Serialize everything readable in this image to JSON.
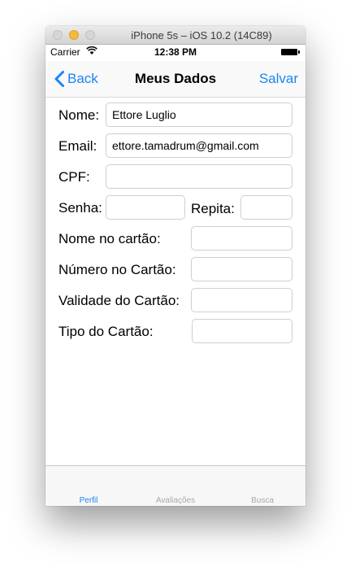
{
  "window": {
    "title": "iPhone 5s – iOS 10.2 (14C89)"
  },
  "status_bar": {
    "carrier": "Carrier",
    "time": "12:38 PM"
  },
  "nav_bar": {
    "back_label": "Back",
    "title": "Meus Dados",
    "save_label": "Salvar"
  },
  "form": {
    "nome_label": "Nome:",
    "nome_value": "Ettore Luglio",
    "email_label": "Email:",
    "email_value": "ettore.tamadrum@gmail.com",
    "cpf_label": "CPF:",
    "cpf_value": "",
    "senha_label": "Senha:",
    "senha_value": "",
    "repita_label": "Repita:",
    "repita_value": "",
    "nome_cartao_label": "Nome no cartão:",
    "nome_cartao_value": "",
    "numero_cartao_label": "Número no Cartão:",
    "numero_cartao_value": "",
    "validade_cartao_label": "Validade do Cartão:",
    "validade_cartao_value": "",
    "tipo_cartao_label": "Tipo do Cartão:",
    "tipo_cartao_value": ""
  },
  "tab_bar": {
    "tabs": [
      {
        "label": "Perfil",
        "selected": true
      },
      {
        "label": "Avaliações",
        "selected": false
      },
      {
        "label": "Busca",
        "selected": false
      }
    ]
  },
  "colors": {
    "accent": "#1a84f5",
    "tab_inactive": "#a8a8a8"
  },
  "icons": {
    "back": "chevron-left-icon",
    "wifi": "wifi-icon",
    "battery": "battery-icon"
  }
}
